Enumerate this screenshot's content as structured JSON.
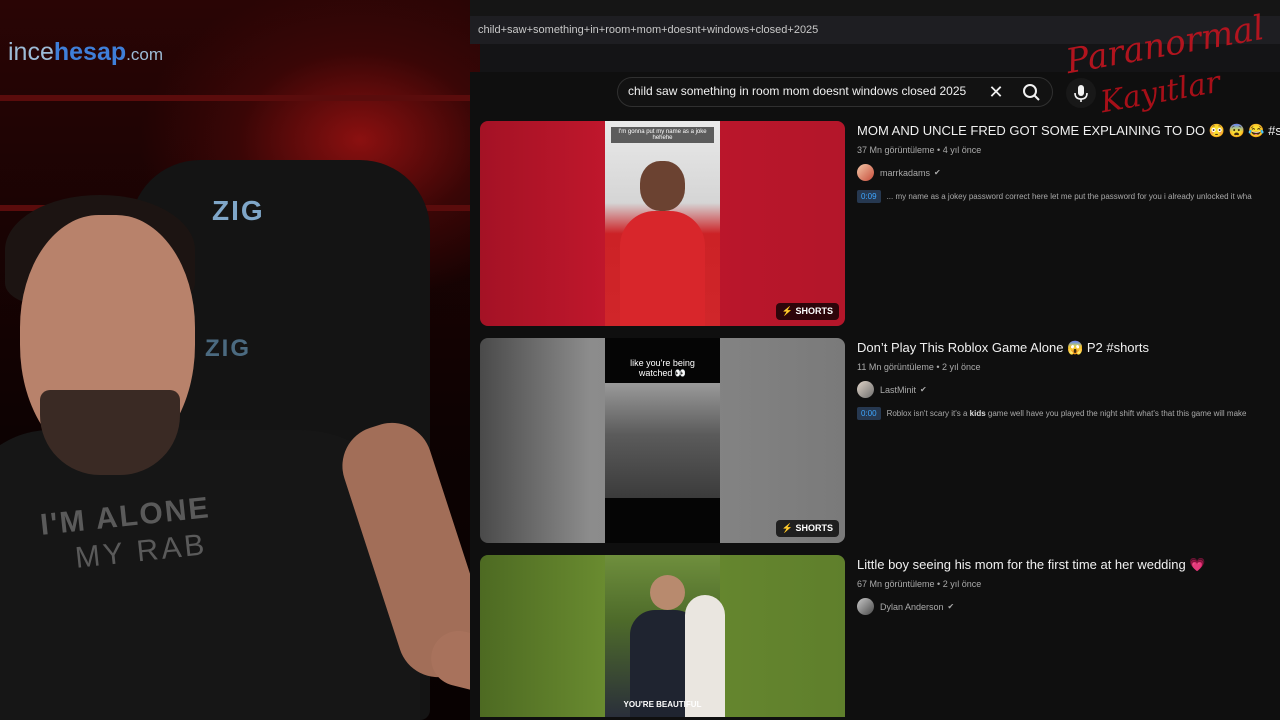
{
  "overlay": {
    "brand_a": "ince",
    "brand_b": "hesap",
    "brand_dom": ".com",
    "paranormal_top": "Paranormal",
    "paranormal_bottom": "Kayıtlar",
    "chair_logo": "ZIG",
    "shirt_line1": "I'M ALONE",
    "shirt_line2": "MY RAB"
  },
  "browser": {
    "url": "child+saw+something+in+room+mom+doesnt+windows+closed+2025"
  },
  "search": {
    "query": "child saw something in room mom doesnt windows closed 2025"
  },
  "results": [
    {
      "title": "MOM AND UNCLE FRED GOT SOME EXPLAINING TO DO 😳 😨 😂 #shorts",
      "views": "37 Mn görüntüleme • 4 yıl önce",
      "channel": "marrkadams",
      "timestamp": "0:09",
      "snippet": "... my name as a jokey password correct here let me put the password for you i already unlocked it wha",
      "thumb_caption": "I'm gonna put my name as a joke hehehe",
      "badge": "SHORTS",
      "bg_color": "#b3162a"
    },
    {
      "title": "Don’t Play This Roblox Game Alone 😱 P2 #shorts",
      "views": "11 Mn görüntüleme • 2 yıl önce",
      "channel": "LastMinit",
      "timestamp": "0:00",
      "snippet_pre": "Roblox isn't scary it's a ",
      "snippet_bold": "kids",
      "snippet_post": " game well have you played the night shift what's that this game will make",
      "thumb_caption": "like you're being watched 👀",
      "badge": "SHORTS",
      "bg_color": "#7a7a7a"
    },
    {
      "title": "Little boy seeing his mom for the first time at her wedding 💗",
      "views": "67 Mn görüntüleme • 2 yıl önce",
      "channel": "Dylan Anderson",
      "thumb_caption": "YOU'RE BEAUTIFUL",
      "bg_color": "#5f7f2c"
    }
  ]
}
